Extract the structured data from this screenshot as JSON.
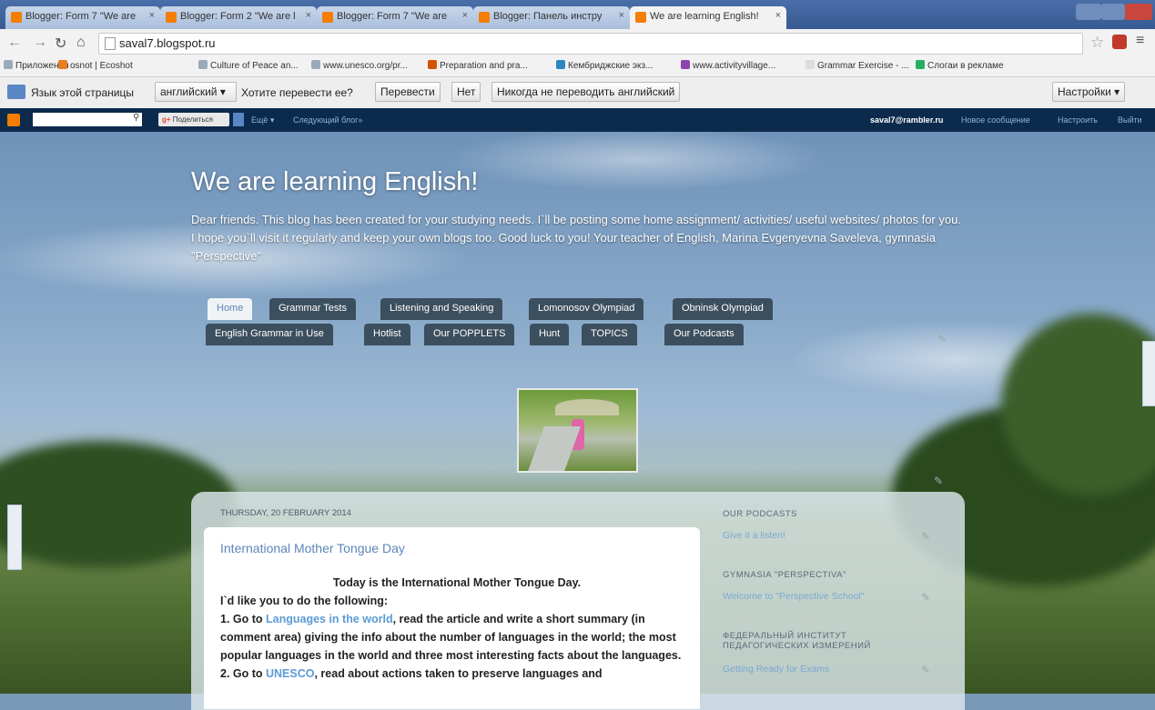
{
  "browser": {
    "tabs": [
      {
        "title": "Blogger: Form 7 \"We are"
      },
      {
        "title": "Blogger: Form 2 \"We are l"
      },
      {
        "title": "Blogger: Form 7 \"We are"
      },
      {
        "title": "Blogger: Панель инстру"
      },
      {
        "title": "We are learning English!"
      }
    ],
    "url": "saval7.blogspot.ru",
    "bookmarks": [
      "Приложения",
      "osnot | Ecoshot",
      "Culture of Peace an...",
      "www.unesco.org/pr...",
      "Preparation and pra...",
      "Кембриджские экз...",
      "www.activityvillage...",
      "Grammar Exercise - ...",
      "Слогаи в рекламе"
    ]
  },
  "translate_bar": {
    "prompt": "Язык этой страницы",
    "language": "английский ▾",
    "question": "Хотите перевести ее?",
    "translate_btn": "Перевести",
    "no_btn": "Нет",
    "never_btn": "Никогда не переводить английский",
    "settings_btn": "Настройки ▾"
  },
  "blogger_nav": {
    "share": "Поделиться",
    "more": "Ещё ▾",
    "next_blog": "Следующий блог»",
    "user": "saval7@rambler.ru",
    "new_post": "Новое сообщение",
    "customize": "Настроить",
    "logout": "Выйти"
  },
  "blog": {
    "title": "We are learning English!",
    "description": "Dear friends. This blog has been created for your studying needs. I`ll be posting some home assignment/ activities/ useful websites/ photos for you. I hope you`ll visit it regularly and keep your own blogs too. Good luck to you! Your teacher of English, Marina Evgenyevna Saveleva, gymnasia \"Perspective\"",
    "tabs_row1": [
      "Home",
      "Grammar Tests",
      "Listening and Speaking",
      "Lomonosov Olympiad",
      "Obninsk Olympiad"
    ],
    "tabs_row2": [
      "English Grammar in Use",
      "Hotlist",
      "Our POPPLETS",
      "Hunt",
      "TOPICS",
      "Our Podcasts"
    ]
  },
  "post": {
    "date": "THURSDAY, 20 FEBRUARY 2014",
    "title": "International Mother Tongue Day",
    "line1": "Today is the International Mother Tongue Day.",
    "line2": "I`d like you to do the following:",
    "line3_pre": "1. Go to ",
    "line3_link": "Languages in the world",
    "line3_post": ", read the article and write a short summary (in comment area) giving the info about the number of languages in the world; the most popular languages in the world and three most interesting facts about the languages.",
    "line4_pre": "2. Go to ",
    "line4_link": "UNESCO",
    "line4_post": ", read about actions taken to preserve languages and"
  },
  "sidebar": [
    {
      "heading": "OUR PODCASTS",
      "link": "Give it a listen!"
    },
    {
      "heading": "GYMNASIA \"PERSPECTIVA\"",
      "link": "Welcome to \"Perspective School\""
    },
    {
      "heading": "ФЕДЕРАЛЬНЫЙ ИНСТИТУТ ПЕДАГОГИЧЕСКИХ ИЗМЕРЕНИЙ",
      "link": "Getting Ready for Exams"
    }
  ],
  "colors": {
    "navbar": "#0b2a4c",
    "tab": "#3c4f5e",
    "link": "#5b9bd5"
  }
}
